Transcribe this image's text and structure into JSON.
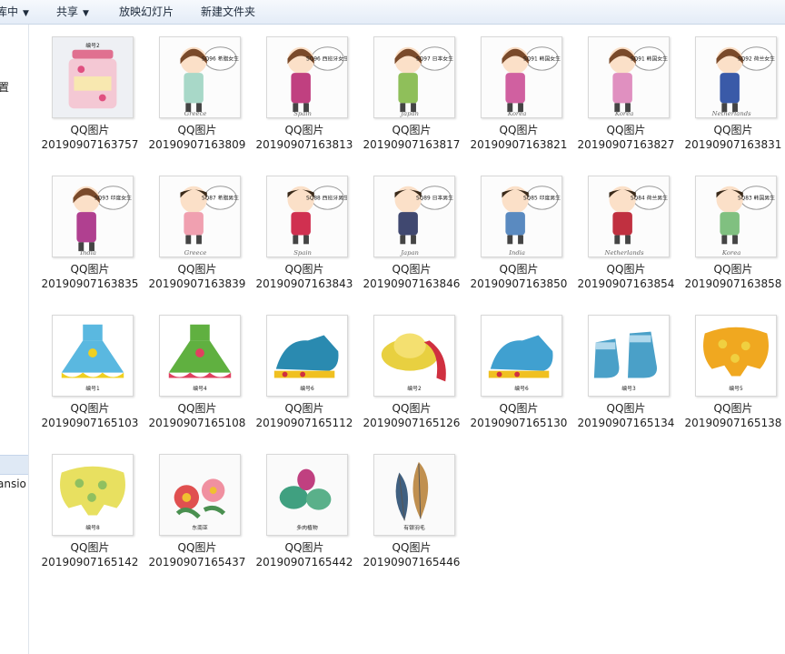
{
  "toolbar": {
    "items": [
      {
        "label": "库中",
        "caret": "▼"
      },
      {
        "label": "共享",
        "caret": "▼"
      },
      {
        "label": "放映幻灯片"
      },
      {
        "label": "新建文件夹"
      }
    ]
  },
  "nav": {
    "labels": [
      "置",
      "ansio"
    ]
  },
  "files": [
    {
      "name": "QQ图片",
      "number": "20190907163757",
      "thumb": "jar",
      "badge": "编号2"
    },
    {
      "name": "QQ图片",
      "number": "20190907163809",
      "thumb": "girl",
      "badge": "SQ96 希腊女生",
      "caption": "Greece",
      "color": "#a8d8c8"
    },
    {
      "name": "QQ图片",
      "number": "20190907163813",
      "thumb": "girl",
      "badge": "SQ96 西班牙女生",
      "caption": "Spain",
      "color": "#c04080"
    },
    {
      "name": "QQ图片",
      "number": "20190907163817",
      "thumb": "girl",
      "badge": "SQ97 日本女生",
      "caption": "Japan",
      "color": "#8fbf5a"
    },
    {
      "name": "QQ图片",
      "number": "20190907163821",
      "thumb": "girl",
      "badge": "SQ91 韩国女生",
      "caption": "Korea",
      "color": "#d060a0"
    },
    {
      "name": "QQ图片",
      "number": "20190907163827",
      "thumb": "girl",
      "badge": "SQ91 韩国女生",
      "caption": "Korea",
      "color": "#e090c0"
    },
    {
      "name": "QQ图片",
      "number": "20190907163831",
      "thumb": "girl",
      "badge": "SQ92 荷兰女生",
      "caption": "Netherlands",
      "color": "#3a5aa8"
    },
    {
      "name": "QQ图片",
      "number": "20190907163835",
      "thumb": "girl",
      "badge": "SQ93 印度女生",
      "caption": "India",
      "color": "#b04090"
    },
    {
      "name": "QQ图片",
      "number": "20190907163839",
      "thumb": "boy",
      "badge": "SQ87 希腊男生",
      "caption": "Greece",
      "color": "#f0a0b0"
    },
    {
      "name": "QQ图片",
      "number": "20190907163843",
      "thumb": "boy",
      "badge": "SQ88 西班牙男生",
      "caption": "Spain",
      "color": "#d03050"
    },
    {
      "name": "QQ图片",
      "number": "20190907163846",
      "thumb": "boy",
      "badge": "SQ89 日本男生",
      "caption": "Japan",
      "color": "#404870"
    },
    {
      "name": "QQ图片",
      "number": "20190907163850",
      "thumb": "boy",
      "badge": "SQ85 印度男生",
      "caption": "India",
      "color": "#5a8ac0"
    },
    {
      "name": "QQ图片",
      "number": "20190907163854",
      "thumb": "boy",
      "badge": "SQ84 荷兰男生",
      "caption": "Netherlands",
      "color": "#c03040"
    },
    {
      "name": "QQ图片",
      "number": "20190907163858",
      "thumb": "boy",
      "badge": "SQ83 韩国男生",
      "caption": "Korea",
      "color": "#80c080"
    },
    {
      "name": "QQ图片",
      "number": "20190907165103",
      "thumb": "dress",
      "badge": "编号1",
      "color": "#5ab8e0",
      "color2": "#f0d020"
    },
    {
      "name": "QQ图片",
      "number": "20190907165108",
      "thumb": "dress",
      "badge": "编号4",
      "color": "#60b040",
      "color2": "#e04060"
    },
    {
      "name": "QQ图片",
      "number": "20190907165112",
      "thumb": "shoe",
      "badge": "编号6",
      "color": "#2a8ab0",
      "color2": "#f0c020"
    },
    {
      "name": "QQ图片",
      "number": "20190907165126",
      "thumb": "hat",
      "badge": "编号2",
      "color": "#e8d040",
      "color2": "#d03040"
    },
    {
      "name": "QQ图片",
      "number": "20190907165130",
      "thumb": "shoe",
      "badge": "编号6",
      "color": "#40a0d0",
      "color2": "#f0c020"
    },
    {
      "name": "QQ图片",
      "number": "20190907165134",
      "thumb": "boots",
      "badge": "编号3",
      "color": "#4aa0c8",
      "color2": "#b0d8ec"
    },
    {
      "name": "QQ图片",
      "number": "20190907165138",
      "thumb": "blob",
      "badge": "编号5",
      "color": "#f0a820",
      "color2": "#f0d040"
    },
    {
      "name": "QQ图片",
      "number": "20190907165142",
      "thumb": "blob",
      "badge": "编号8",
      "color": "#e8e060",
      "color2": "#90c060"
    },
    {
      "name": "QQ图片",
      "number": "20190907165437",
      "thumb": "flowers",
      "badge": "东南亚",
      "color": "#e05050",
      "color2": "#f090a0"
    },
    {
      "name": "QQ图片",
      "number": "20190907165442",
      "thumb": "succulent",
      "badge": "多肉植物",
      "color": "#40a080",
      "color2": "#c04080"
    },
    {
      "name": "QQ图片",
      "number": "20190907165446",
      "thumb": "feather",
      "badge": "有银羽毛",
      "color": "#c09050",
      "color2": "#406080"
    }
  ]
}
